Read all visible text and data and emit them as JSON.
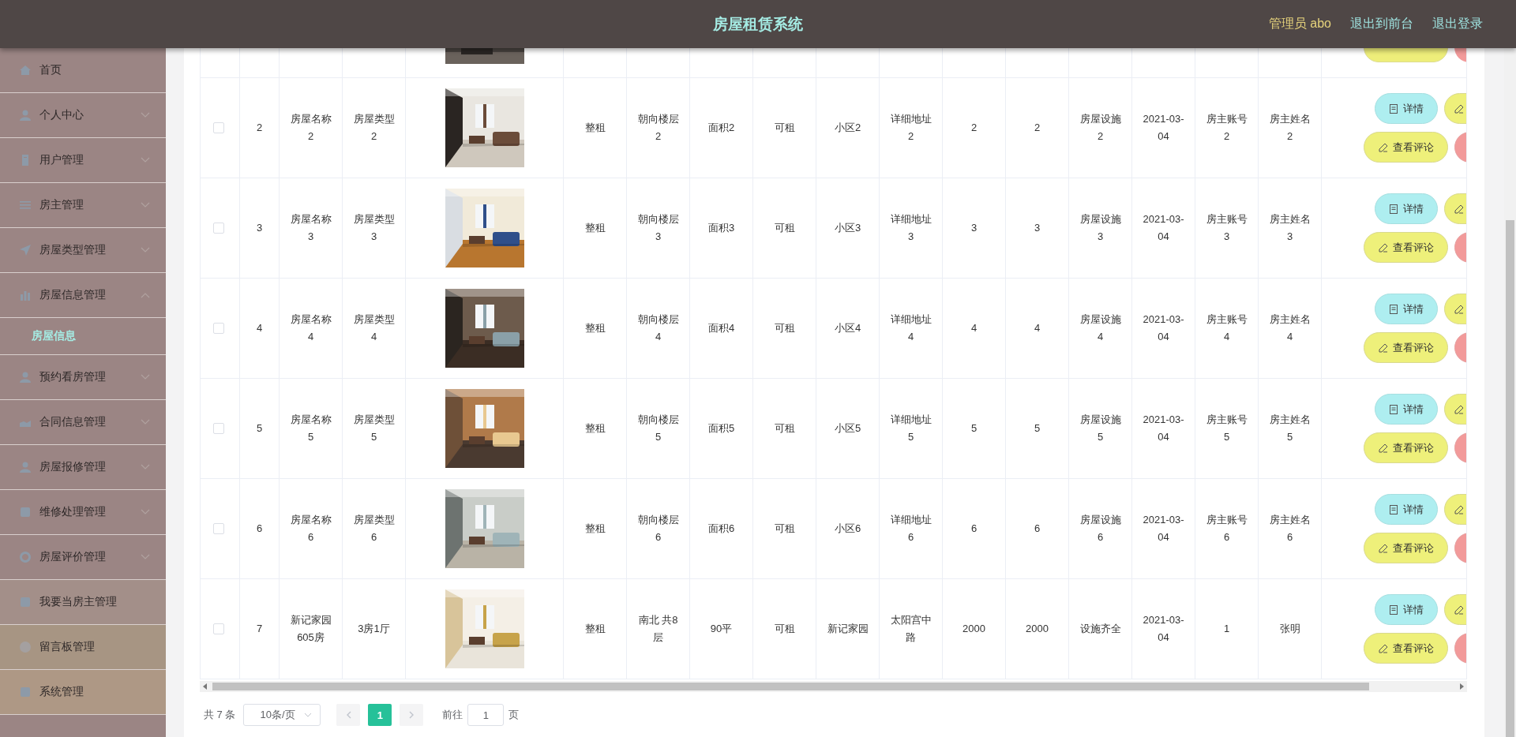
{
  "header": {
    "title": "房屋租赁系统",
    "user": "管理员 abo",
    "links": [
      "退出到前台",
      "退出登录"
    ]
  },
  "sidebar": {
    "items": [
      {
        "label": "首页",
        "has_children": false,
        "expanded": false,
        "color": "#9b8584"
      },
      {
        "label": "个人中心",
        "has_children": true,
        "expanded": false,
        "color": "#9b8584"
      },
      {
        "label": "用户管理",
        "has_children": true,
        "expanded": false,
        "color": "#9b8584"
      },
      {
        "label": "房主管理",
        "has_children": true,
        "expanded": false,
        "color": "#9b8584"
      },
      {
        "label": "房屋类型管理",
        "has_children": true,
        "expanded": false,
        "color": "#9b8584"
      },
      {
        "label": "房屋信息管理",
        "has_children": true,
        "expanded": true,
        "color": "#9b8584",
        "children": [
          {
            "label": "房屋信息",
            "selected": true
          }
        ]
      },
      {
        "label": "预约看房管理",
        "has_children": true,
        "expanded": false,
        "color": "#9b8584"
      },
      {
        "label": "合同信息管理",
        "has_children": true,
        "expanded": false,
        "color": "#9b8584"
      },
      {
        "label": "房屋报修管理",
        "has_children": true,
        "expanded": false,
        "color": "#9b8584"
      },
      {
        "label": "维修处理管理",
        "has_children": true,
        "expanded": false,
        "color": "#9b8584"
      },
      {
        "label": "房屋评价管理",
        "has_children": true,
        "expanded": false,
        "color": "#9b8584"
      },
      {
        "label": "我要当房主管理",
        "has_children": false,
        "expanded": false,
        "color": "#a38f89"
      },
      {
        "label": "留言板管理",
        "has_children": false,
        "expanded": false,
        "color": "#a79583"
      },
      {
        "label": "系统管理",
        "has_children": false,
        "expanded": false,
        "color": "#ae9885"
      }
    ]
  },
  "table": {
    "rows": [
      {
        "checked": false,
        "cells": [
          "2",
          "房屋名称2",
          "房屋类型2",
          "整租",
          "朝向楼层2",
          "面积2",
          "可租",
          "小区2",
          "详细地址2",
          "2",
          "2",
          "房屋设施2",
          "2021-03-04",
          "房主账号2",
          "房主姓名2"
        ],
        "actions": [
          {
            "kind": "detail",
            "label": "详情"
          },
          {
            "kind": "edit"
          },
          {
            "kind": "review",
            "label": "查看评论"
          },
          {
            "kind": "delete"
          }
        ]
      },
      {
        "checked": false,
        "cells": [
          "3",
          "房屋名称3",
          "房屋类型3",
          "整租",
          "朝向楼层3",
          "面积3",
          "可租",
          "小区3",
          "详细地址3",
          "3",
          "3",
          "房屋设施3",
          "2021-03-04",
          "房主账号3",
          "房主姓名3"
        ],
        "actions": [
          {
            "kind": "detail",
            "label": "详情"
          },
          {
            "kind": "edit"
          },
          {
            "kind": "review",
            "label": "查看评论"
          },
          {
            "kind": "delete"
          }
        ]
      },
      {
        "checked": false,
        "cells": [
          "4",
          "房屋名称4",
          "房屋类型4",
          "整租",
          "朝向楼层4",
          "面积4",
          "可租",
          "小区4",
          "详细地址4",
          "4",
          "4",
          "房屋设施4",
          "2021-03-04",
          "房主账号4",
          "房主姓名4"
        ],
        "actions": [
          {
            "kind": "detail",
            "label": "详情"
          },
          {
            "kind": "edit"
          },
          {
            "kind": "review",
            "label": "查看评论"
          },
          {
            "kind": "delete"
          }
        ]
      },
      {
        "checked": false,
        "cells": [
          "5",
          "房屋名称5",
          "房屋类型5",
          "整租",
          "朝向楼层5",
          "面积5",
          "可租",
          "小区5",
          "详细地址5",
          "5",
          "5",
          "房屋设施5",
          "2021-03-04",
          "房主账号5",
          "房主姓名5"
        ],
        "actions": [
          {
            "kind": "detail",
            "label": "详情"
          },
          {
            "kind": "edit"
          },
          {
            "kind": "review",
            "label": "查看评论"
          },
          {
            "kind": "delete"
          }
        ]
      },
      {
        "checked": false,
        "cells": [
          "6",
          "房屋名称6",
          "房屋类型6",
          "整租",
          "朝向楼层6",
          "面积6",
          "可租",
          "小区6",
          "详细地址6",
          "6",
          "6",
          "房屋设施6",
          "2021-03-04",
          "房主账号6",
          "房主姓名6"
        ],
        "actions": [
          {
            "kind": "detail",
            "label": "详情"
          },
          {
            "kind": "edit"
          },
          {
            "kind": "review",
            "label": "查看评论"
          },
          {
            "kind": "delete"
          }
        ]
      },
      {
        "checked": false,
        "cells": [
          "7",
          "新记家园605房",
          "3房1厅",
          "整租",
          "南北 共8层",
          "90平",
          "可租",
          "新记家园",
          "太阳宫中路",
          "2000",
          "2000",
          "设施齐全",
          "2021-03-04",
          "1",
          "张明"
        ],
        "actions": [
          {
            "kind": "detail",
            "label": "详情"
          },
          {
            "kind": "edit"
          },
          {
            "kind": "review",
            "label": "查看评论"
          },
          {
            "kind": "delete"
          }
        ]
      }
    ]
  },
  "pagination": {
    "total": "共 7 条",
    "page_size": "10条/页",
    "pages": [
      {
        "label": "1",
        "selected": true
      }
    ],
    "goto_label": "前往",
    "goto_value": "1",
    "goto_suffix": "页"
  }
}
